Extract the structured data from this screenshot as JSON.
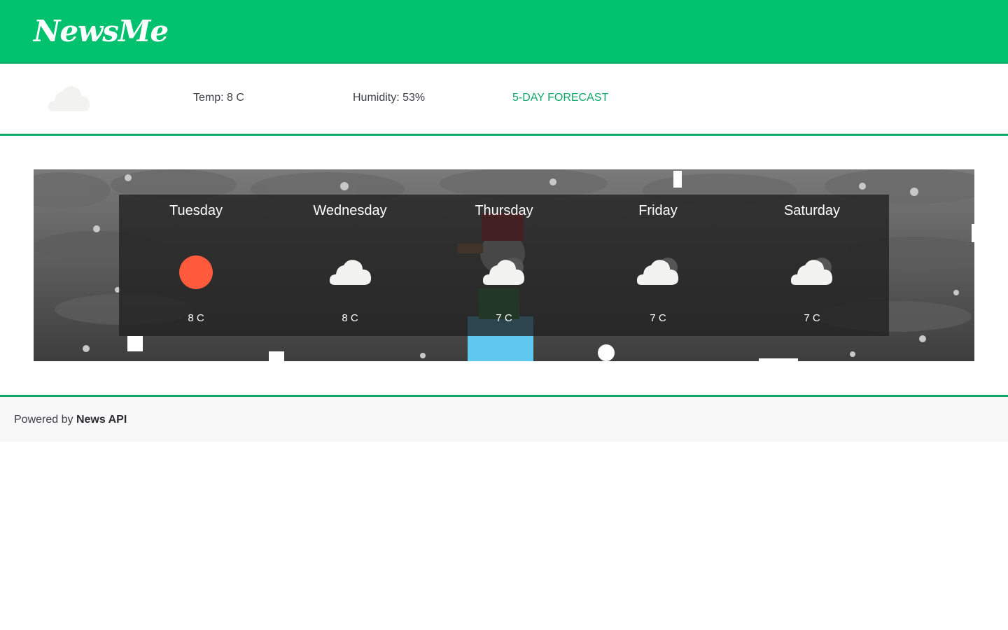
{
  "header": {
    "logo": "NewsMe"
  },
  "current": {
    "icon": "cloud-icon",
    "temp_label": "Temp: 8 C",
    "humidity_label": "Humidity: 53%",
    "forecast_link": "5-DAY FORECAST"
  },
  "forecast": {
    "days": [
      {
        "name": "Tuesday",
        "icon": "sun-icon",
        "temp": "8 C"
      },
      {
        "name": "Wednesday",
        "icon": "cloud-icon",
        "temp": "8 C"
      },
      {
        "name": "Thursday",
        "icon": "cloudy-icon",
        "temp": "7 C"
      },
      {
        "name": "Friday",
        "icon": "cloudy-icon",
        "temp": "7 C"
      },
      {
        "name": "Saturday",
        "icon": "cloudy-icon",
        "temp": "7 C"
      }
    ]
  },
  "footer": {
    "prefix": "Powered by ",
    "link": "News API"
  },
  "colors": {
    "brand": "#00c16e",
    "accent": "#0ea766",
    "sun": "#ff5a3c",
    "cloud": "#f2f2f0"
  }
}
